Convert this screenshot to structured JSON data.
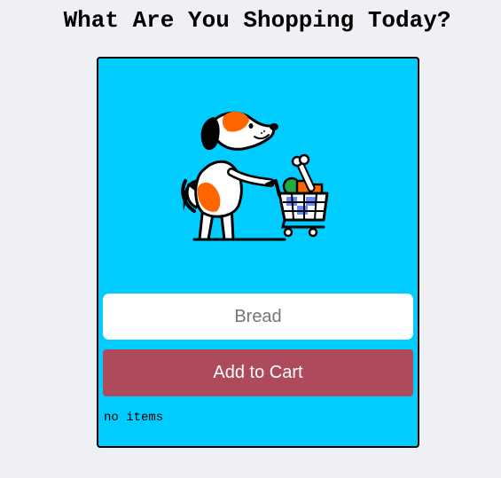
{
  "page": {
    "title": "What Are You Shopping Today?"
  },
  "card": {
    "mascot_icon": "dog-pushing-shopping-cart-icon",
    "input": {
      "placeholder": "Bread",
      "value": ""
    },
    "add_button_label": "Add to Cart",
    "status_text": "no items"
  },
  "colors": {
    "page_background": "#eef0f4",
    "card_background": "#00ccff",
    "button_background": "#ad4a5c",
    "button_text": "#ffffff"
  }
}
